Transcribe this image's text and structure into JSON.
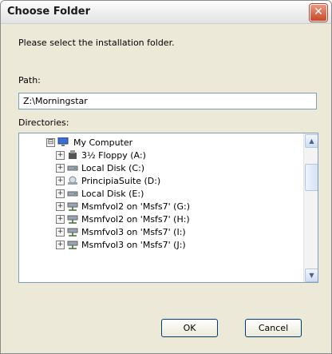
{
  "dialog": {
    "title": "Choose Folder",
    "close_symbol": "✕",
    "instruction": "Please select the installation folder.",
    "path_label": "Path:",
    "path_value": "Z:\\Morningstar",
    "directories_label": "Directories:",
    "ok_label": "OK",
    "cancel_label": "Cancel"
  },
  "tree": {
    "root": {
      "label": "My Computer",
      "icon": "computer-icon",
      "expander": "⊟"
    },
    "items": [
      {
        "label": "3½ Floppy (A:)",
        "icon": "floppy-drive-icon",
        "expander": "+"
      },
      {
        "label": "Local Disk (C:)",
        "icon": "hard-drive-icon",
        "expander": "+"
      },
      {
        "label": "PrincipiaSuite (D:)",
        "icon": "cd-drive-icon",
        "expander": "+"
      },
      {
        "label": "Local Disk (E:)",
        "icon": "hard-drive-icon",
        "expander": "+"
      },
      {
        "label": "Msmfvol2 on 'Msfs7' (G:)",
        "icon": "network-drive-icon",
        "expander": "+"
      },
      {
        "label": "Msmfvol2 on 'Msfs7' (H:)",
        "icon": "network-drive-icon",
        "expander": "+"
      },
      {
        "label": "Msmfvol3 on 'Msfs7' (I:)",
        "icon": "network-drive-icon",
        "expander": "+"
      },
      {
        "label": "Msmfvol3 on 'Msfs7' (J:)",
        "icon": "network-drive-icon",
        "expander": "+"
      }
    ]
  },
  "scrollbar": {
    "up": "▲",
    "down": "▼"
  }
}
